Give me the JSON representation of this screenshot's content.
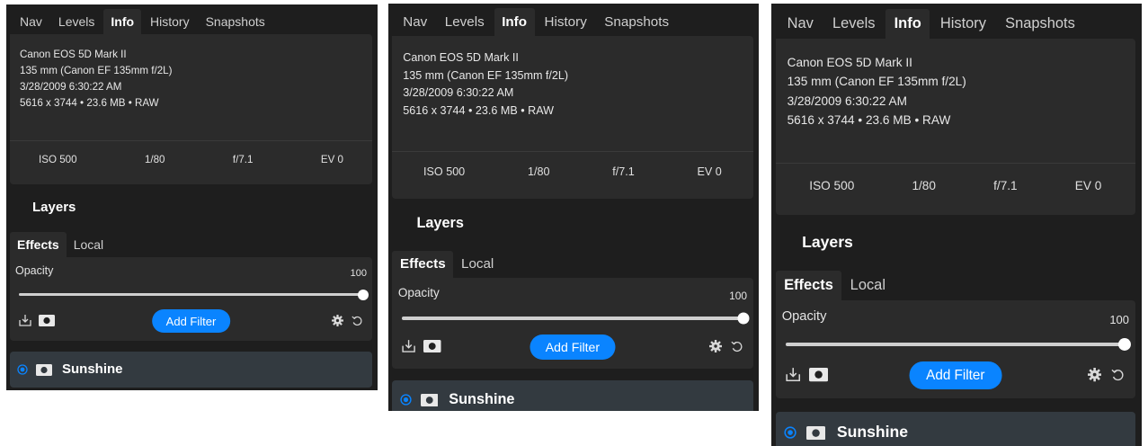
{
  "tabs": [
    "Nav",
    "Levels",
    "Info",
    "History",
    "Snapshots"
  ],
  "active_tab": "Info",
  "info": {
    "lines": [
      "Canon EOS 5D Mark II",
      "135 mm (Canon EF 135mm f/2L)",
      "3/28/2009 6:30:22 AM",
      "5616 x 3744 • 23.6 MB • RAW"
    ],
    "exif": [
      "ISO 500",
      "1/80",
      "f/7.1",
      "EV 0"
    ]
  },
  "layers": {
    "title": "Layers",
    "sub_tabs": [
      "Effects",
      "Local"
    ],
    "active_sub_tab": "Effects",
    "opacity_label": "Opacity",
    "opacity_value": "100",
    "opacity_fraction": 1.0,
    "add_filter_label": "Add Filter",
    "layer_name": "Sunshine"
  },
  "icons": {
    "export": "export-icon",
    "mask": "mask-icon",
    "gear": "gear-icon",
    "reset": "reset-icon",
    "radio": "radio-selected-icon"
  },
  "colors": {
    "accent": "#0a84ff",
    "panel_bg": "#1e1e1e",
    "section_bg": "#2b2b2b",
    "layer_row_bg": "#333a40"
  }
}
